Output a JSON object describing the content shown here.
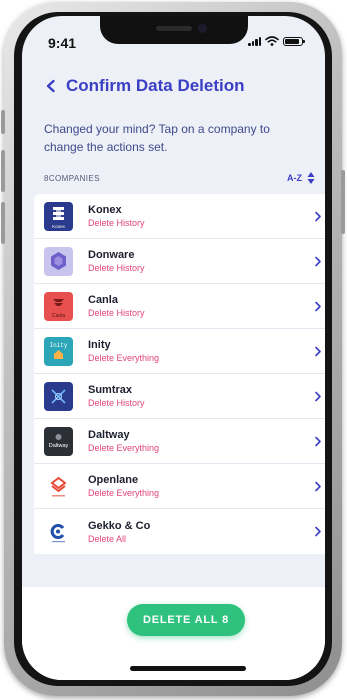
{
  "status_bar": {
    "time": "9:41"
  },
  "header": {
    "title": "Confirm Data Deletion"
  },
  "subtitle": "Changed your mind? Tap on a company to change the actions set.",
  "list_meta": {
    "count_label": "8COMPANIES",
    "sort_label": "A-Z"
  },
  "companies": [
    {
      "name": "Konex",
      "action": "Delete History",
      "logo_text": "Konex",
      "color": "#2a3a8c"
    },
    {
      "name": "Donware",
      "action": "Delete History",
      "logo_text": "",
      "color": "#b8b0e8"
    },
    {
      "name": "Canla",
      "action": "Delete History",
      "logo_text": "Canla",
      "color": "#e85050"
    },
    {
      "name": "Inity",
      "action": "Delete Everything",
      "logo_text": "Inity",
      "color": "#2aa6b8"
    },
    {
      "name": "Sumtrax",
      "action": "Delete History",
      "logo_text": "",
      "color": "#2a3a8c"
    },
    {
      "name": "Daltway",
      "action": "Delete Everything",
      "logo_text": "Daltway",
      "color": "#2d2f36"
    },
    {
      "name": "Openlane",
      "action": "Delete Everything",
      "logo_text": "",
      "color": "#ffffff"
    },
    {
      "name": "Gekko & Co",
      "action": "Delete All",
      "logo_text": "",
      "color": "#ffffff"
    }
  ],
  "footer": {
    "delete_button": "DELETE ALL 8"
  },
  "colors": {
    "accent": "#3b3fc4",
    "action_pink": "#e2457a",
    "button_green": "#2ec27e"
  }
}
